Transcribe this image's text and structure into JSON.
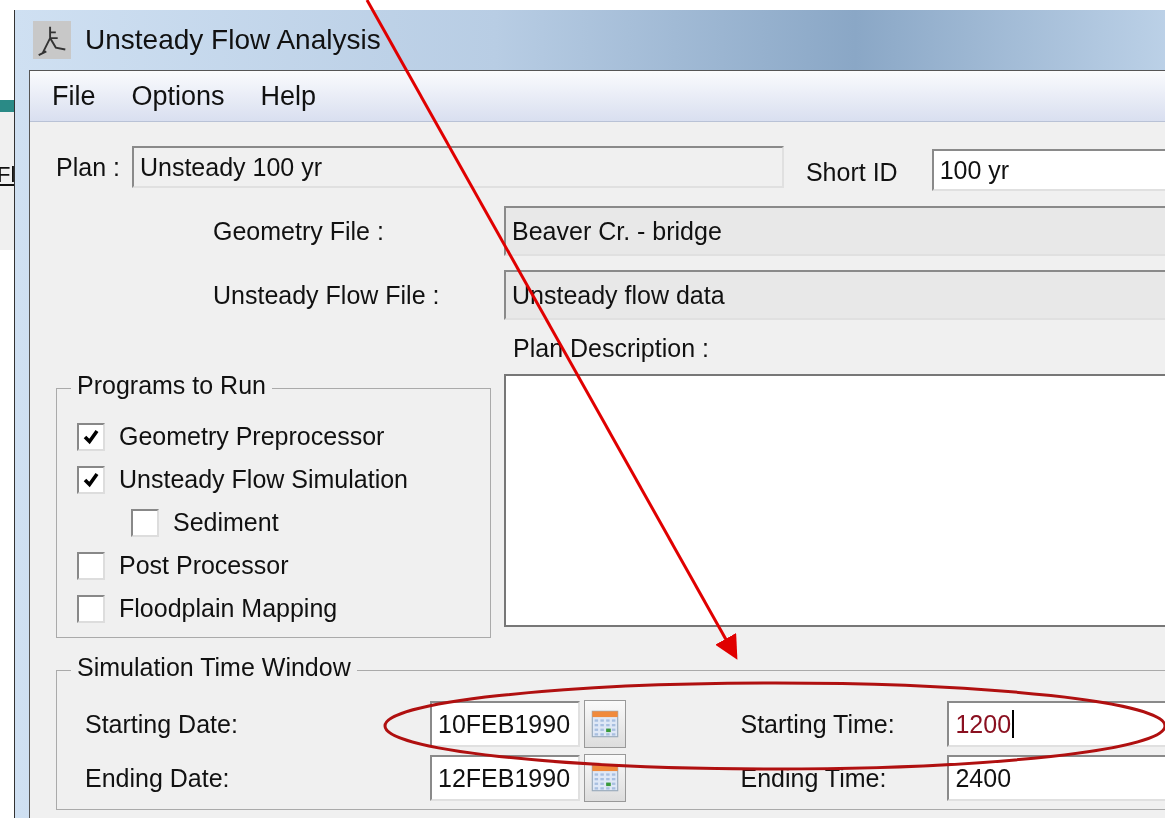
{
  "background": {
    "fragment": "Fl"
  },
  "window": {
    "title": "Unsteady Flow Analysis"
  },
  "menu": [
    "File",
    "Options",
    "Help"
  ],
  "plan": {
    "label": "Plan :",
    "value": "Unsteady 100 yr"
  },
  "short_id": {
    "label": "Short ID",
    "value": "100 yr"
  },
  "files": [
    {
      "label": "Geometry File :",
      "value": "Beaver Cr.  - bridge"
    },
    {
      "label": "Unsteady Flow File :",
      "value": "Unsteady flow data"
    }
  ],
  "plan_description": {
    "label": "Plan Description :"
  },
  "programs": {
    "title": "Programs to Run",
    "items": [
      {
        "label": "Geometry Preprocessor",
        "checked": true
      },
      {
        "label": "Unsteady Flow Simulation",
        "checked": true,
        "children": [
          {
            "label": "Sediment",
            "checked": false
          }
        ]
      },
      {
        "label": "Post Processor",
        "checked": false
      },
      {
        "label": "Floodplain Mapping",
        "checked": false
      }
    ]
  },
  "time_window": {
    "title": "Simulation Time Window",
    "rows": [
      {
        "date_label": "Starting Date:",
        "date": "10FEB1990",
        "time_label": "Starting Time:",
        "time": "1200",
        "focused": true
      },
      {
        "date_label": "Ending Date:",
        "date": "12FEB1990",
        "time_label": "Ending Time:",
        "time": "2400",
        "focused": false
      }
    ]
  }
}
